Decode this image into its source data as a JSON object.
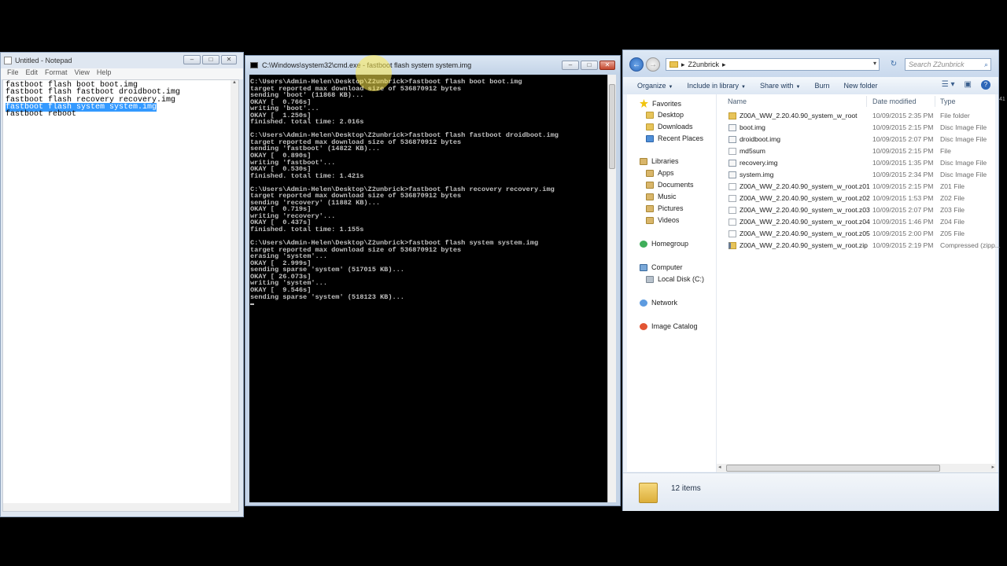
{
  "notepad": {
    "title": "Untitled - Notepad",
    "menu": [
      "File",
      "Edit",
      "Format",
      "View",
      "Help"
    ],
    "lines": [
      "fastboot flash boot boot.img",
      "fastboot flash fastboot droidboot.img",
      "fastboot flash recovery recovery.img",
      "fastboot flash system system.img",
      "fastboot reboot"
    ],
    "selected_line_index": 3
  },
  "cmd": {
    "title": "C:\\Windows\\system32\\cmd.exe - fastboot  flash system system.img",
    "lines": [
      "C:\\Users\\Admin-Helen\\Desktop\\Z2unbrick>fastboot flash boot boot.img",
      "target reported max download size of 536870912 bytes",
      "sending 'boot' (11868 KB)...",
      "OKAY [  0.766s]",
      "writing 'boot'...",
      "OKAY [  1.250s]",
      "finished. total time: 2.016s",
      "",
      "C:\\Users\\Admin-Helen\\Desktop\\Z2unbrick>fastboot flash fastboot droidboot.img",
      "target reported max download size of 536870912 bytes",
      "sending 'fastboot' (14822 KB)...",
      "OKAY [  0.890s]",
      "writing 'fastboot'...",
      "OKAY [  0.530s]",
      "finished. total time: 1.421s",
      "",
      "C:\\Users\\Admin-Helen\\Desktop\\Z2unbrick>fastboot flash recovery recovery.img",
      "target reported max download size of 536870912 bytes",
      "sending 'recovery' (11882 KB)...",
      "OKAY [  0.719s]",
      "writing 'recovery'...",
      "OKAY [  0.437s]",
      "finished. total time: 1.155s",
      "",
      "C:\\Users\\Admin-Helen\\Desktop\\Z2unbrick>fastboot flash system system.img",
      "target reported max download size of 536870912 bytes",
      "erasing 'system'...",
      "OKAY [  2.999s]",
      "sending sparse 'system' (517015 KB)...",
      "OKAY [ 26.073s]",
      "writing 'system'...",
      "OKAY [  9.546s]",
      "sending sparse 'system' (518123 KB)..."
    ]
  },
  "explorer": {
    "address_segments": [
      "Z2unbrick"
    ],
    "search_placeholder": "Search Z2unbrick",
    "toolbar": [
      "Organize",
      "Include in library",
      "Share with",
      "Burn",
      "New folder"
    ],
    "nav": {
      "favorites_label": "Favorites",
      "favorites": [
        "Desktop",
        "Downloads",
        "Recent Places"
      ],
      "libraries_label": "Libraries",
      "libraries": [
        "Apps",
        "Documents",
        "Music",
        "Pictures",
        "Videos"
      ],
      "homegroup_label": "Homegroup",
      "computer_label": "Computer",
      "computer": [
        "Local Disk (C:)"
      ],
      "network_label": "Network",
      "image_catalog_label": "Image Catalog"
    },
    "columns": {
      "name": "Name",
      "date": "Date modified",
      "type": "Type"
    },
    "files": [
      {
        "name": "Z00A_WW_2.20.40.90_system_w_root",
        "date": "10/09/2015 2:35 PM",
        "type": "File folder",
        "icon": "folder"
      },
      {
        "name": "boot.img",
        "date": "10/09/2015 2:15 PM",
        "type": "Disc Image File",
        "icon": "img"
      },
      {
        "name": "droidboot.img",
        "date": "10/09/2015 2:07 PM",
        "type": "Disc Image File",
        "icon": "img"
      },
      {
        "name": "md5sum",
        "date": "10/09/2015 2:15 PM",
        "type": "File",
        "icon": "file"
      },
      {
        "name": "recovery.img",
        "date": "10/09/2015 1:35 PM",
        "type": "Disc Image File",
        "icon": "img"
      },
      {
        "name": "system.img",
        "date": "10/09/2015 2:34 PM",
        "type": "Disc Image File",
        "icon": "img"
      },
      {
        "name": "Z00A_WW_2.20.40.90_system_w_root.z01",
        "date": "10/09/2015 2:15 PM",
        "type": "Z01 File",
        "icon": "file"
      },
      {
        "name": "Z00A_WW_2.20.40.90_system_w_root.z02",
        "date": "10/09/2015 1:53 PM",
        "type": "Z02 File",
        "icon": "file"
      },
      {
        "name": "Z00A_WW_2.20.40.90_system_w_root.z03",
        "date": "10/09/2015 2:07 PM",
        "type": "Z03 File",
        "icon": "file"
      },
      {
        "name": "Z00A_WW_2.20.40.90_system_w_root.z04",
        "date": "10/09/2015 1:46 PM",
        "type": "Z04 File",
        "icon": "file"
      },
      {
        "name": "Z00A_WW_2.20.40.90_system_w_root.z05",
        "date": "10/09/2015 2:00 PM",
        "type": "Z05 File",
        "icon": "file"
      },
      {
        "name": "Z00A_WW_2.20.40.90_system_w_root.zip",
        "date": "10/09/2015 2:19 PM",
        "type": "Compressed (zipp...",
        "icon": "zip"
      }
    ],
    "status_count": "12 items"
  },
  "edge_fragment": "41"
}
